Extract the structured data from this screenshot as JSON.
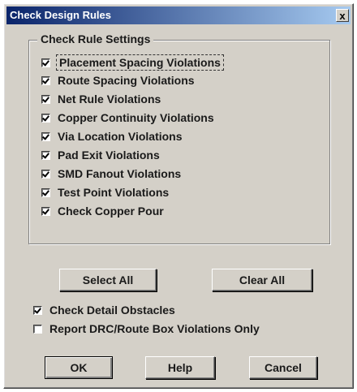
{
  "window": {
    "title": "Check Design Rules",
    "close_symbol": "x"
  },
  "group": {
    "legend": "Check Rule Settings",
    "items": [
      {
        "label": "Placement Spacing Violations",
        "checked": true
      },
      {
        "label": "Route Spacing Violations",
        "checked": true
      },
      {
        "label": "Net Rule Violations",
        "checked": true
      },
      {
        "label": "Copper Continuity Violations",
        "checked": true
      },
      {
        "label": "Via Location Violations",
        "checked": true
      },
      {
        "label": "Pad Exit Violations",
        "checked": true
      },
      {
        "label": "SMD Fanout Violations",
        "checked": true
      },
      {
        "label": "Test Point Violations",
        "checked": true
      },
      {
        "label": "Check Copper Pour",
        "checked": true
      }
    ]
  },
  "buttons": {
    "select_all": "Select All",
    "clear_all": "Clear All",
    "ok": "OK",
    "help": "Help",
    "cancel": "Cancel"
  },
  "options": [
    {
      "label": "Check Detail Obstacles",
      "checked": true
    },
    {
      "label": "Report DRC/Route Box Violations Only",
      "checked": false
    }
  ]
}
